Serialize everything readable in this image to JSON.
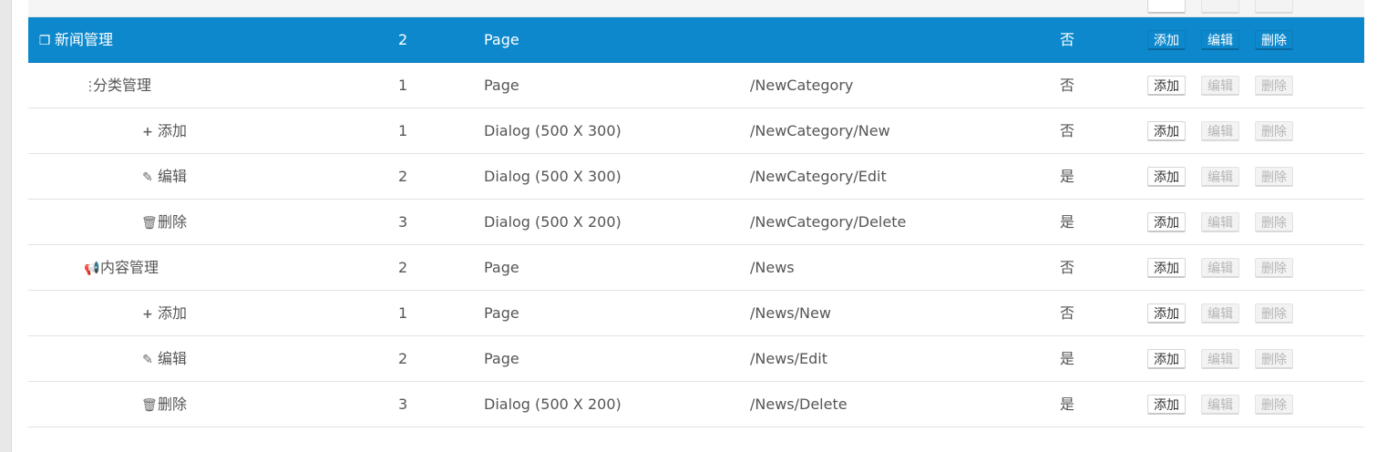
{
  "colors": {
    "active_row_bg": "#0e88cc",
    "border": "#e2e2e2"
  },
  "rows": [
    {
      "name": "新闻管理",
      "icon": "bookmark-icon",
      "order": "2",
      "type": "Page",
      "url": "",
      "hidden": "否",
      "ops": [
        "添加",
        "编辑",
        "删除"
      ]
    },
    {
      "name": "分类管理",
      "icon": "ellipsis-vertical-icon",
      "order": "1",
      "type": "Page",
      "url": "/NewCategory",
      "hidden": "否",
      "ops": [
        "添加",
        "编辑",
        "删除"
      ]
    },
    {
      "name": "添加",
      "icon": "plus-icon",
      "order": "1",
      "type": "Dialog (500 X 300)",
      "url": "/NewCategory/New",
      "hidden": "否",
      "ops": [
        "添加",
        "编辑",
        "删除"
      ]
    },
    {
      "name": "编辑",
      "icon": "pencil-icon",
      "order": "2",
      "type": "Dialog (500 X 300)",
      "url": "/NewCategory/Edit",
      "hidden": "是",
      "ops": [
        "添加",
        "编辑",
        "删除"
      ]
    },
    {
      "name": "删除",
      "icon": "trash-icon",
      "order": "3",
      "type": "Dialog (500 X 200)",
      "url": "/NewCategory/Delete",
      "hidden": "是",
      "ops": [
        "添加",
        "编辑",
        "删除"
      ]
    },
    {
      "name": "内容管理",
      "icon": "bullhorn-icon",
      "order": "2",
      "type": "Page",
      "url": "/News",
      "hidden": "否",
      "ops": [
        "添加",
        "编辑",
        "删除"
      ]
    },
    {
      "name": "添加",
      "icon": "plus-icon",
      "order": "1",
      "type": "Page",
      "url": "/News/New",
      "hidden": "否",
      "ops": [
        "添加",
        "编辑",
        "删除"
      ]
    },
    {
      "name": "编辑",
      "icon": "pencil-icon",
      "order": "2",
      "type": "Page",
      "url": "/News/Edit",
      "hidden": "是",
      "ops": [
        "添加",
        "编辑",
        "删除"
      ]
    },
    {
      "name": "删除",
      "icon": "trash-icon",
      "order": "3",
      "type": "Dialog (500 X 200)",
      "url": "/News/Delete",
      "hidden": "是",
      "ops": [
        "添加",
        "编辑",
        "删除"
      ]
    }
  ]
}
